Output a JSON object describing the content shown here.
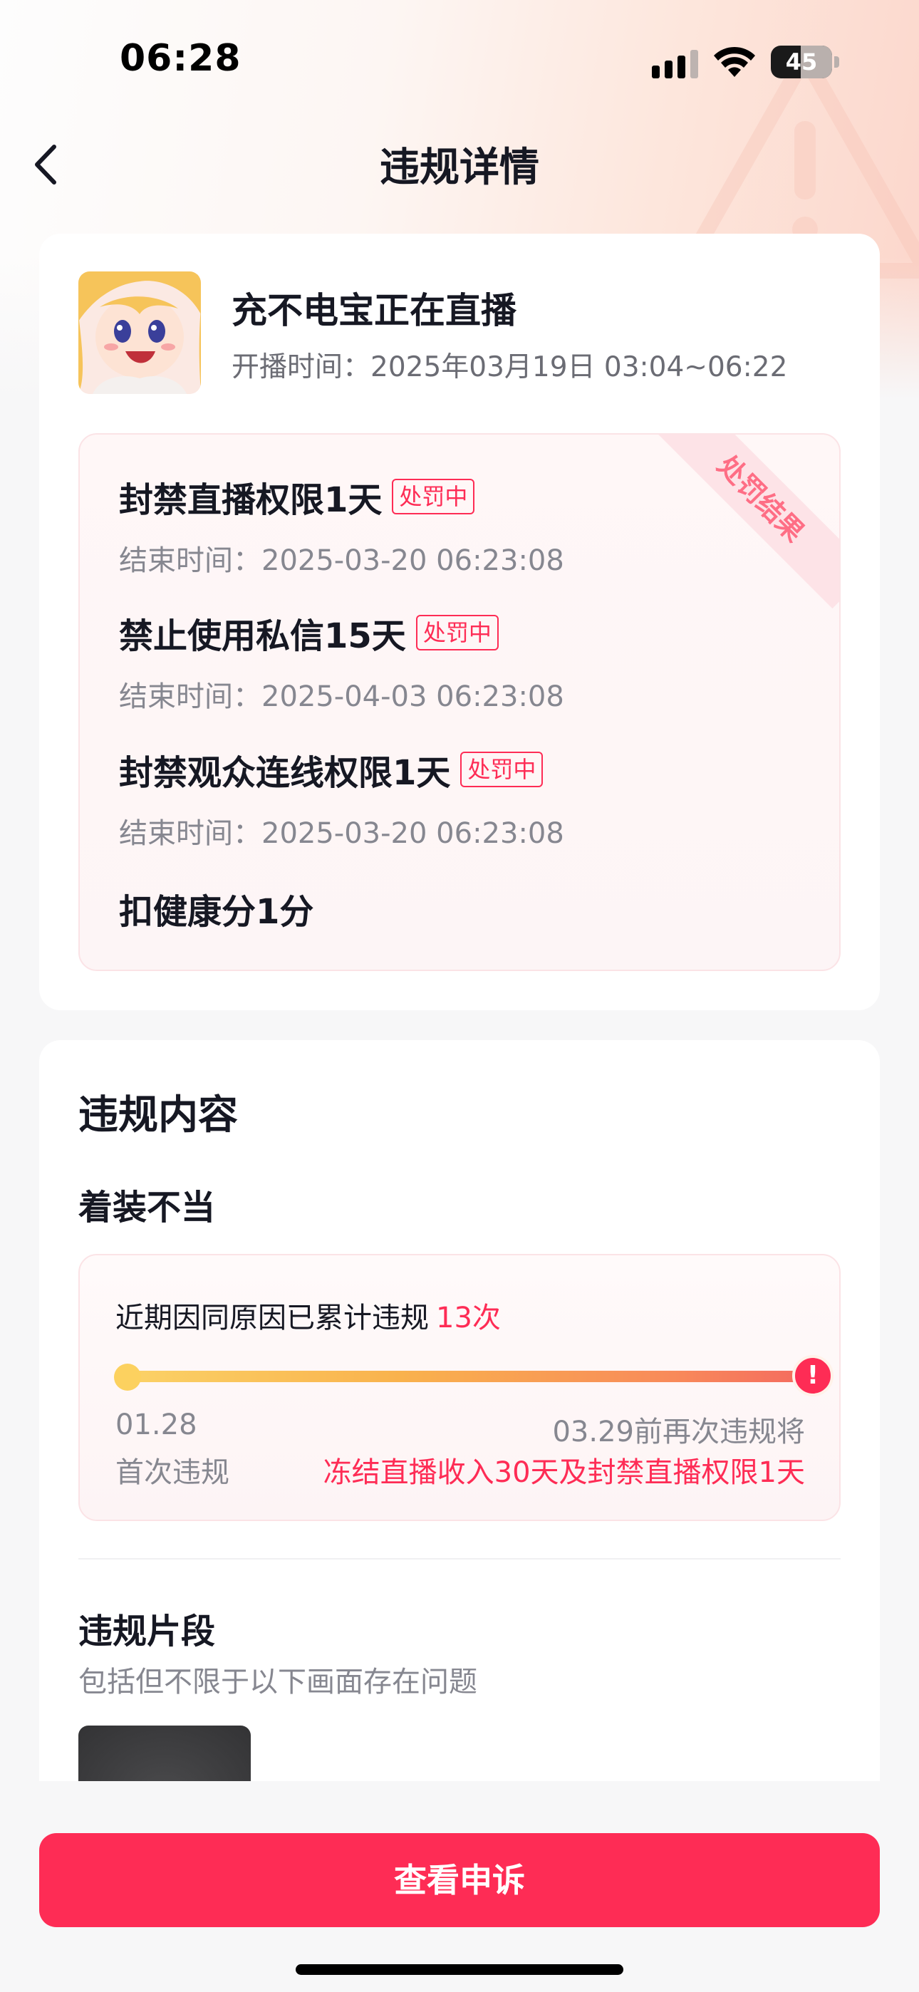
{
  "status_bar": {
    "time": "06:28",
    "battery": "45"
  },
  "nav": {
    "title": "违规详情"
  },
  "stream": {
    "title": "充不电宝正在直播",
    "time_label": "开播时间：",
    "time_value": "2025年03月19日 03:04~06:22"
  },
  "penalty": {
    "ribbon": "处罚结果",
    "items": [
      {
        "name": "封禁直播权限1天",
        "badge": "处罚中",
        "end": "结束时间：2025-03-20 06:23:08"
      },
      {
        "name": "禁止使用私信15天",
        "badge": "处罚中",
        "end": "结束时间：2025-04-03 06:23:08"
      },
      {
        "name": "封禁观众连线权限1天",
        "badge": "处罚中",
        "end": "结束时间：2025-03-20 06:23:08"
      }
    ],
    "health": "扣健康分1分"
  },
  "violation": {
    "section_title": "违规内容",
    "type": "着装不当",
    "count_text": "近期因同原因已累计违规",
    "count_value": "13次",
    "start_date": "01.28",
    "start_label": "首次违规",
    "end_text": "03.29前再次违规将",
    "end_warning": "冻结直播收入30天及封禁直播权限1天",
    "end_icon": "!"
  },
  "clip": {
    "title": "违规片段",
    "desc": "包括但不限于以下画面存在问题"
  },
  "actions": {
    "appeal_label": "查看申诉"
  },
  "colors": {
    "accent": "#fe2c55",
    "text_primary": "#161823",
    "text_secondary": "#868790"
  }
}
